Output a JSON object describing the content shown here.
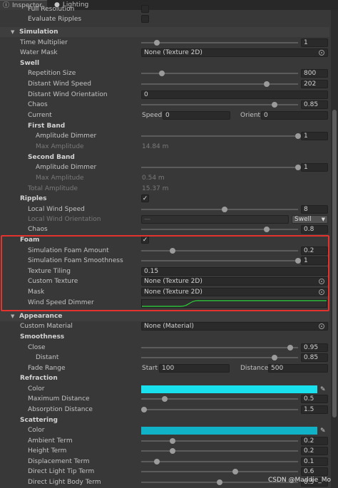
{
  "tabs": [
    {
      "label": "Inspector",
      "icon": "info-icon"
    },
    {
      "label": "Lighting",
      "icon": "lightbulb-icon"
    }
  ],
  "rows": {
    "full_resolution": {
      "label": "Full Resolution"
    },
    "evaluate_ripples": {
      "label": "Evaluate Ripples"
    },
    "simulation": {
      "label": "Simulation"
    },
    "time_multiplier": {
      "label": "Time Multiplier",
      "value": "1",
      "slider_fraction": 0.1
    },
    "water_mask": {
      "label": "Water Mask",
      "value": "None (Texture 2D)"
    },
    "swell": {
      "label": "Swell"
    },
    "repetition_size": {
      "label": "Repetition Size",
      "value": "800",
      "slider_fraction": 0.13
    },
    "distant_wind_speed": {
      "label": "Distant Wind Speed",
      "value": "202",
      "slider_fraction": 0.8
    },
    "distant_wind_orientation": {
      "label": "Distant Wind Orientation",
      "value": "0"
    },
    "chaos": {
      "label": "Chaos",
      "value": "0.85",
      "slider_fraction": 0.85
    },
    "current": {
      "label": "Current",
      "speed_label": "Speed",
      "speed_value": "0",
      "orient_label": "Orient",
      "orient_value": "0"
    },
    "first_band": {
      "label": "First Band"
    },
    "amplitude_dimmer_1": {
      "label": "Amplitude Dimmer",
      "value": "1",
      "slider_fraction": 1.0
    },
    "max_amplitude_1": {
      "label": "Max Amplitude",
      "value": "14.84 m"
    },
    "second_band": {
      "label": "Second Band"
    },
    "amplitude_dimmer_2": {
      "label": "Amplitude Dimmer",
      "value": "1",
      "slider_fraction": 1.0
    },
    "max_amplitude_2": {
      "label": "Max Amplitude",
      "value": "0.54 m"
    },
    "total_amplitude": {
      "label": "Total Amplitude",
      "value": "15.37 m"
    },
    "ripples": {
      "label": "Ripples"
    },
    "local_wind_speed": {
      "label": "Local Wind Speed",
      "value": "8",
      "slider_fraction": 0.53
    },
    "local_wind_orientation": {
      "label": "Local Wind Orientation",
      "value": "—",
      "dropdown": "Swell"
    },
    "chaos_ripples": {
      "label": "Chaos",
      "value": "0.8",
      "slider_fraction": 0.8
    },
    "foam": {
      "label": "Foam"
    },
    "simulation_foam_amount": {
      "label": "Simulation Foam Amount",
      "value": "0.2",
      "slider_fraction": 0.2
    },
    "simulation_foam_smoothness": {
      "label": "Simulation Foam Smoothness",
      "value": "1",
      "slider_fraction": 1.0
    },
    "texture_tiling": {
      "label": "Texture Tiling",
      "value": "0.15"
    },
    "custom_texture": {
      "label": "Custom Texture",
      "value": "None (Texture 2D)"
    },
    "mask": {
      "label": "Mask",
      "value": "None (Texture 2D)"
    },
    "wind_speed_dimmer": {
      "label": "Wind Speed Dimmer"
    },
    "appearance": {
      "label": "Appearance"
    },
    "custom_material": {
      "label": "Custom Material",
      "value": "None (Material)"
    },
    "smoothness": {
      "label": "Smoothness"
    },
    "close": {
      "label": "Close",
      "value": "0.95",
      "slider_fraction": 0.95
    },
    "distant": {
      "label": "Distant",
      "value": "0.85",
      "slider_fraction": 0.85
    },
    "fade_range": {
      "label": "Fade Range",
      "start_label": "Start",
      "start_value": "100",
      "distance_label": "Distance",
      "distance_value": "500"
    },
    "refraction": {
      "label": "Refraction"
    },
    "refraction_color": {
      "label": "Color",
      "color": "#18e0ec"
    },
    "maximum_distance": {
      "label": "Maximum Distance",
      "value": "0.5",
      "slider_fraction": 0.15
    },
    "absorption_distance": {
      "label": "Absorption Distance",
      "value": "1.5",
      "slider_fraction": 0.02
    },
    "scattering": {
      "label": "Scattering"
    },
    "scattering_color": {
      "label": "Color",
      "color": "#0fb2c6"
    },
    "ambient_term": {
      "label": "Ambient Term",
      "value": "0.2",
      "slider_fraction": 0.2
    },
    "height_term": {
      "label": "Height Term",
      "value": "0.2",
      "slider_fraction": 0.2
    },
    "displacement_term": {
      "label": "Displacement Term",
      "value": "0.1",
      "slider_fraction": 0.1
    },
    "direct_light_tip_term": {
      "label": "Direct Light Tip Term",
      "value": "0.6",
      "slider_fraction": 0.6
    },
    "direct_light_body_term": {
      "label": "Direct Light Body Term",
      "value": "0.5",
      "slider_fraction": 0.5
    }
  },
  "watermark": "CSDN @Maddie_Mo",
  "colors": {
    "highlight": "#e4322f",
    "curve": "#2bd63a"
  }
}
